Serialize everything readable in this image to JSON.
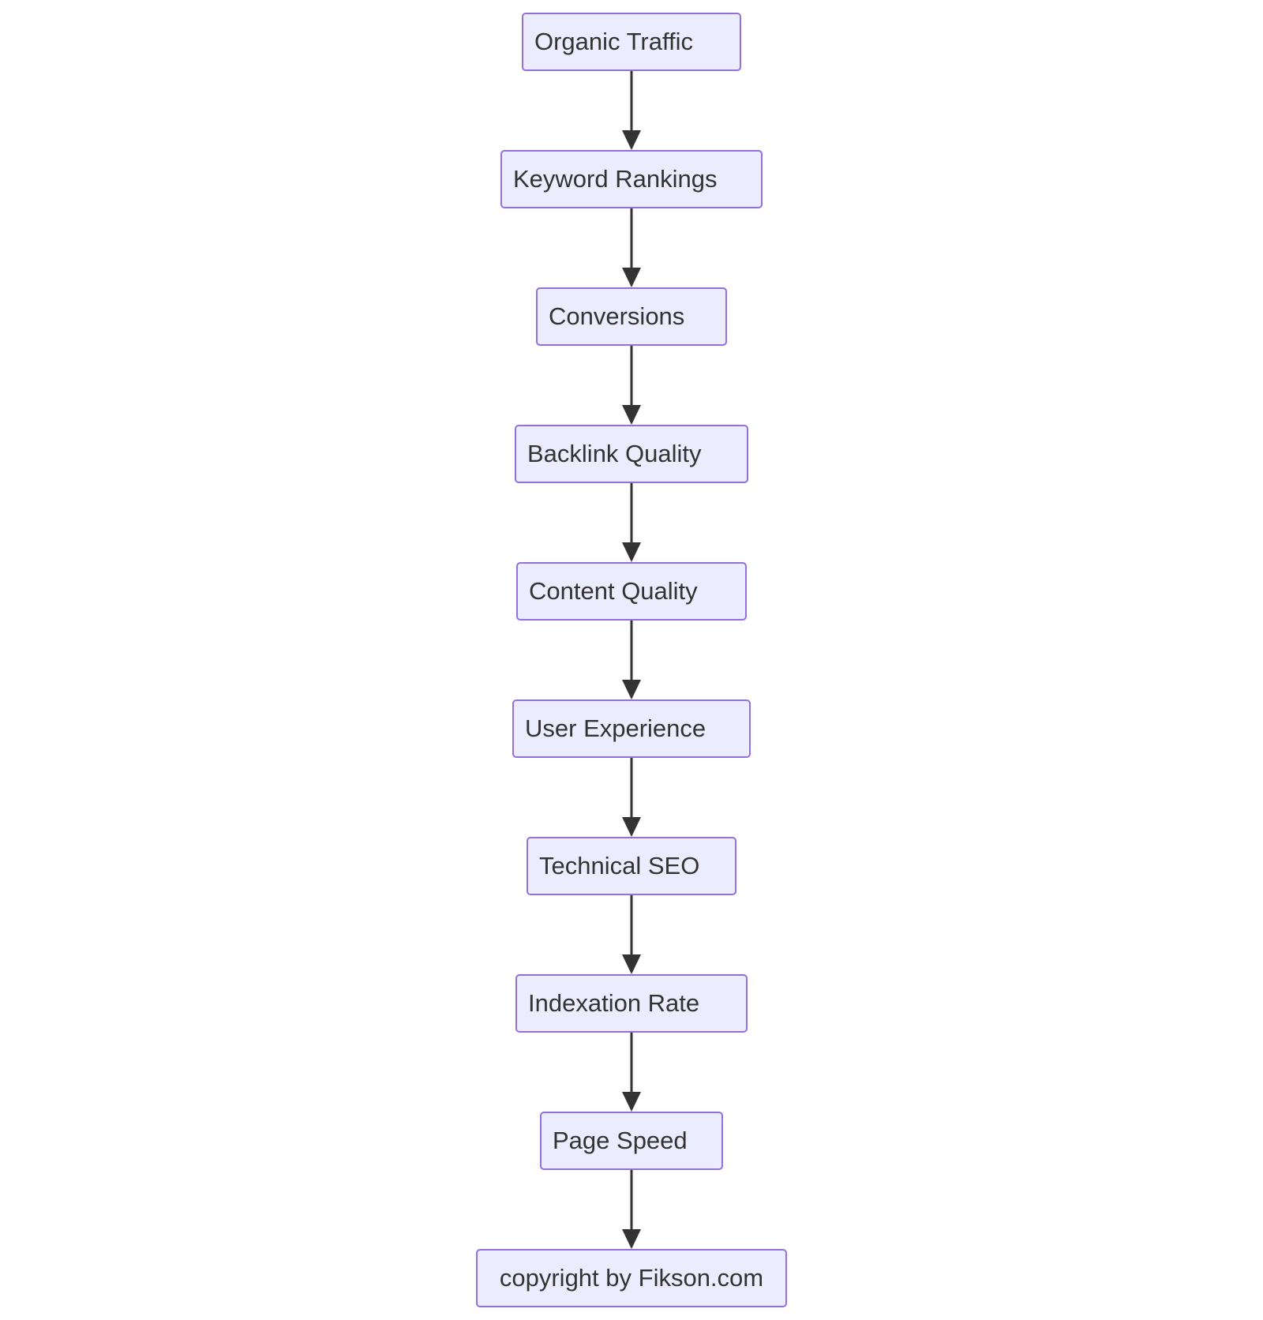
{
  "diagram": {
    "type": "flowchart",
    "direction": "top-to-bottom",
    "colors": {
      "node_fill": "#ECECFF",
      "node_border": "#9370DB",
      "text": "#333333",
      "edge": "#333333"
    },
    "nodes": [
      {
        "id": "organic-traffic",
        "label": "Organic Traffic"
      },
      {
        "id": "keyword-rankings",
        "label": "Keyword Rankings"
      },
      {
        "id": "conversions",
        "label": "Conversions"
      },
      {
        "id": "backlink-quality",
        "label": "Backlink Quality"
      },
      {
        "id": "content-quality",
        "label": "Content Quality"
      },
      {
        "id": "user-experience",
        "label": "User Experience"
      },
      {
        "id": "technical-seo",
        "label": "Technical SEO"
      },
      {
        "id": "indexation-rate",
        "label": "Indexation Rate"
      },
      {
        "id": "page-speed",
        "label": "Page Speed"
      },
      {
        "id": "copyright",
        "label": "copyright by Fikson.com"
      }
    ],
    "edges": [
      {
        "from": "organic-traffic",
        "to": "keyword-rankings"
      },
      {
        "from": "keyword-rankings",
        "to": "conversions"
      },
      {
        "from": "conversions",
        "to": "backlink-quality"
      },
      {
        "from": "backlink-quality",
        "to": "content-quality"
      },
      {
        "from": "content-quality",
        "to": "user-experience"
      },
      {
        "from": "user-experience",
        "to": "technical-seo"
      },
      {
        "from": "technical-seo",
        "to": "indexation-rate"
      },
      {
        "from": "indexation-rate",
        "to": "page-speed"
      },
      {
        "from": "page-speed",
        "to": "copyright"
      }
    ]
  }
}
